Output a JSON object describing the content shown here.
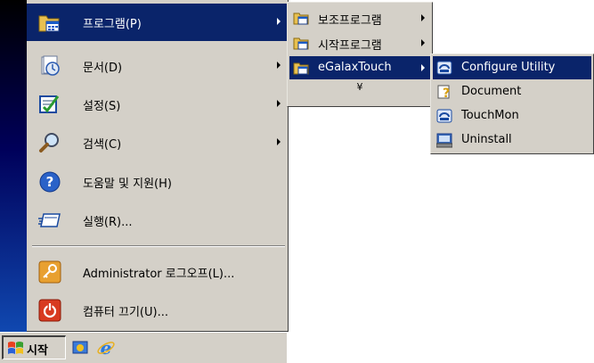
{
  "start_menu": {
    "items": [
      {
        "label": "프로그램(P)",
        "icon": "programs-folder-icon",
        "has_submenu": true,
        "active": true
      },
      {
        "label": "문서(D)",
        "icon": "documents-icon",
        "has_submenu": true
      },
      {
        "label": "설정(S)",
        "icon": "settings-icon",
        "has_submenu": true
      },
      {
        "label": "검색(C)",
        "icon": "search-icon",
        "has_submenu": true
      },
      {
        "label": "도움말 및 지원(H)",
        "icon": "help-icon",
        "has_submenu": false
      },
      {
        "label": "실행(R)...",
        "icon": "run-icon",
        "has_submenu": false
      },
      {
        "label": "Administrator 로그오프(L)...",
        "icon": "logoff-key-icon",
        "has_submenu": false
      },
      {
        "label": "컴퓨터 끄기(U)...",
        "icon": "power-icon",
        "has_submenu": false
      }
    ]
  },
  "programs_submenu": {
    "items": [
      {
        "label": "보조프로그램",
        "icon": "program-group-icon",
        "has_submenu": true
      },
      {
        "label": "시작프로그램",
        "icon": "program-group-icon",
        "has_submenu": true
      },
      {
        "label": "eGalaxTouch",
        "icon": "program-group-icon",
        "has_submenu": true,
        "active": true
      }
    ],
    "expand_glyph": "¥"
  },
  "egalax_submenu": {
    "items": [
      {
        "label": "Configure Utility",
        "icon": "configure-utility-icon",
        "active": true
      },
      {
        "label": "Document",
        "icon": "document-help-icon"
      },
      {
        "label": "TouchMon",
        "icon": "touchmon-icon"
      },
      {
        "label": "Uninstall",
        "icon": "uninstall-icon"
      }
    ]
  },
  "taskbar": {
    "start_label": "시작",
    "quick_launch": [
      "show-desktop-icon",
      "internet-explorer-icon"
    ]
  },
  "colors": {
    "menu_bg": "#d4d0c8",
    "highlight": "#0a246a",
    "banner_top": "#000000",
    "banner_bottom": "#1048b0"
  }
}
